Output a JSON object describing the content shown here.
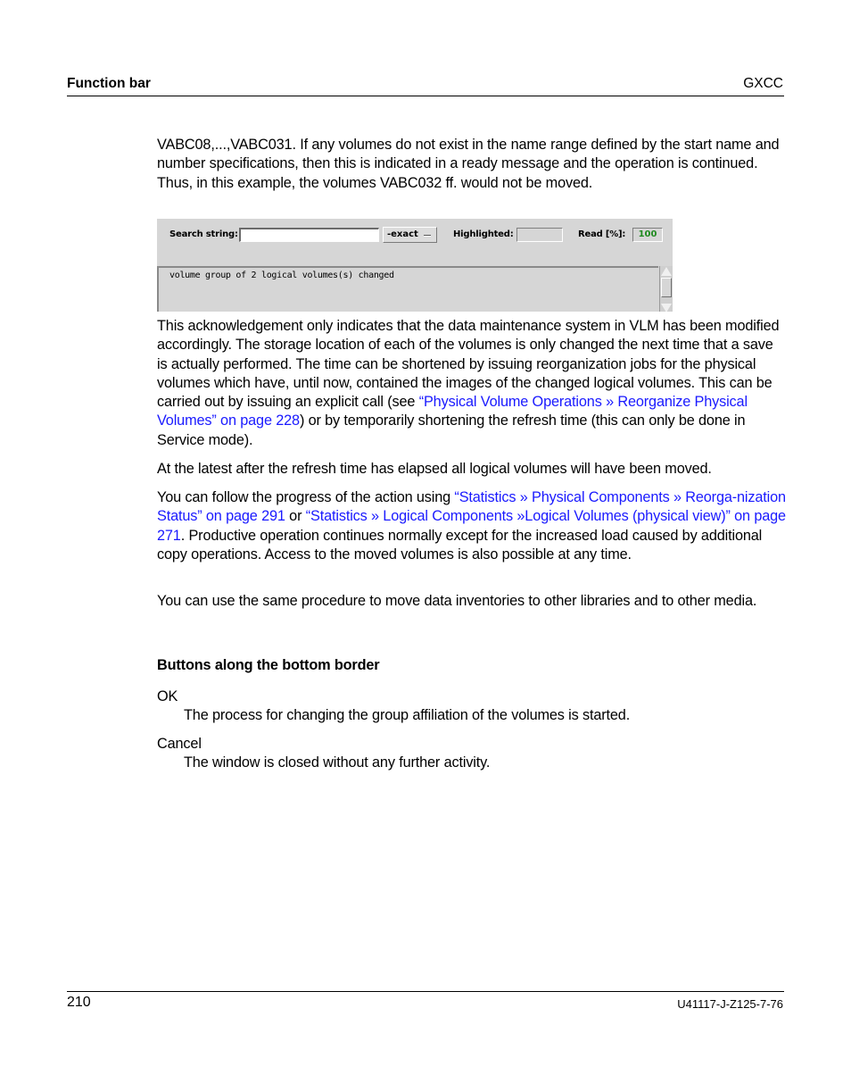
{
  "header": {
    "section_title": "Function bar",
    "product": "GXCC"
  },
  "intro_paragraph": "VABC08,...,VABC031. If any volumes do not exist in the name range defined by the start name and number specifications, then this is indicated in a ready message and the operation is continued. Thus, in this example, the volumes VABC032 ff. would not be moved.",
  "screenshot": {
    "search_label": "Search string:",
    "search_value": "",
    "exact_button_label": "-exact",
    "highlighted_label": "Highlighted:",
    "highlighted_value": "",
    "read_label": "Read [%]:",
    "read_value": "100",
    "message": "volume group of 2 logical volumes(s) changed",
    "read_value_color": "#1f8a1f"
  },
  "paragraphs": {
    "ack_part1": "This acknowledgement only indicates that the data maintenance system in VLM has been modified accordingly. The storage location of each of the volumes is only changed the next time that a save is actually performed. The time can be shortened by issuing reorganization jobs for the physical volumes which have, until now, contained the images of the changed logical volumes. This can be carried out by issuing an explicit call (see ",
    "ack_link": "“Physical Volume Operations » Reorganize Physical Volumes” on page 228",
    "ack_part2": ") or by temporarily shortening the refresh time (this can only be done in Service mode).",
    "latest": "At the latest after the refresh time has elapsed all logical volumes will have been moved.",
    "progress_part1": "You can follow the progress of the action using ",
    "progress_link1": "“Statistics » Physical Components » Reorga-nization Status” on page 291",
    "progress_or": " or ",
    "progress_link2": "“Statistics » Logical Components »Logical Volumes (physical view)” on page 271",
    "progress_part2": ". Productive operation continues normally except for the increased load caused by additional copy operations. Access to the moved volumes is also possible at any time.",
    "same_procedure": "You can use the same procedure to move data inventories to other libraries and to other media."
  },
  "buttons_section": {
    "heading": "Buttons along the bottom border",
    "items": [
      {
        "term": "OK",
        "description": "The process for changing the group affiliation of the volumes is started."
      },
      {
        "term": "Cancel",
        "description": "The window is closed without any further activity."
      }
    ]
  },
  "footer": {
    "page_number": "210",
    "doc_id": "U41117-J-Z125-7-76"
  },
  "colors": {
    "link": "#1a1aff",
    "panel_bg": "#d6d6d6"
  }
}
